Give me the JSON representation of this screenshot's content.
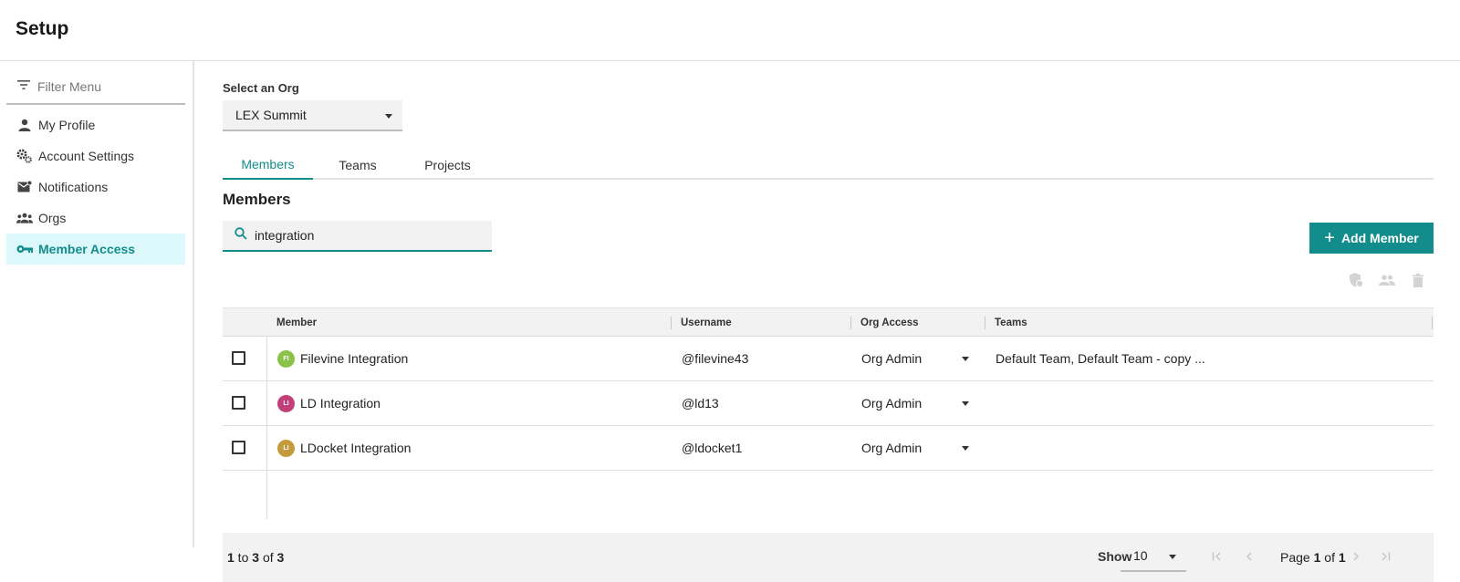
{
  "header": {
    "title": "Setup"
  },
  "sidebar": {
    "filter_placeholder": "Filter Menu",
    "items": [
      {
        "label": "My Profile",
        "icon": "person-icon"
      },
      {
        "label": "Account Settings",
        "icon": "gears-icon"
      },
      {
        "label": "Notifications",
        "icon": "mail-icon"
      },
      {
        "label": "Orgs",
        "icon": "group-icon"
      },
      {
        "label": "Member Access",
        "icon": "key-icon",
        "active": true
      }
    ]
  },
  "org": {
    "label": "Select an Org",
    "selected": "LEX Summit"
  },
  "tabs": [
    {
      "label": "Members",
      "active": true
    },
    {
      "label": "Teams"
    },
    {
      "label": "Projects"
    }
  ],
  "members": {
    "title": "Members",
    "search_value": "integration",
    "add_label": "Add Member",
    "columns": [
      "Member",
      "Username",
      "Org Access",
      "Teams"
    ],
    "rows": [
      {
        "initials": "FI",
        "avatar_color": "#8bc34a",
        "name": "Filevine Integration",
        "username": "@filevine43",
        "access": "Org Admin",
        "teams": "Default Team, Default Team - copy ..."
      },
      {
        "initials": "LI",
        "avatar_color": "#c2407a",
        "name": "LD Integration",
        "username": "@ld13",
        "access": "Org Admin",
        "teams": ""
      },
      {
        "initials": "LI",
        "avatar_color": "#c39a3c",
        "name": "LDocket Integration",
        "username": "@ldocket1",
        "access": "Org Admin",
        "teams": ""
      }
    ]
  },
  "footer": {
    "range_start": "1",
    "range_to": " to ",
    "range_end": "3",
    "range_of": " of ",
    "range_total": "3",
    "show_label": "Show",
    "page_size": "10",
    "page_word": "Page ",
    "page_current": "1",
    "page_of": " of ",
    "page_total": "1"
  },
  "colors": {
    "accent": "#128d8b",
    "active_bg": "#dcf8fa"
  }
}
